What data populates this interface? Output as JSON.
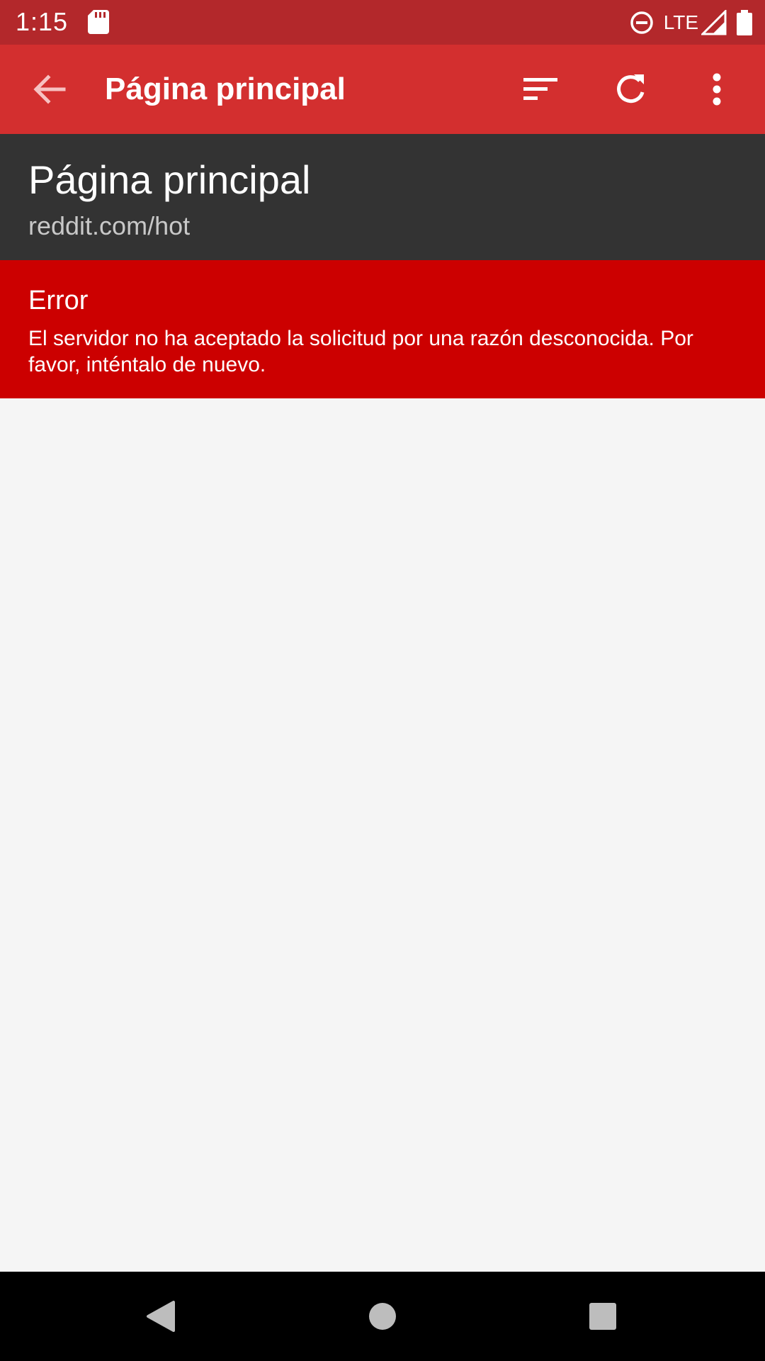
{
  "status_bar": {
    "time": "1:15",
    "network": "LTE",
    "icons": [
      "sd-card-icon",
      "do-not-disturb-icon",
      "signal-icon",
      "battery-icon"
    ]
  },
  "app_bar": {
    "title": "Página principal",
    "background": "#d32f2f",
    "actions": [
      "back-arrow-icon",
      "sort-icon",
      "refresh-icon",
      "more-vert-icon"
    ]
  },
  "subreddit_header": {
    "title": "Página principal",
    "url": "reddit.com/hot",
    "background": "#333333"
  },
  "error": {
    "title": "Error",
    "message": "El servidor no ha aceptado la solicitud por una razón desconocida. Por favor, inténtalo de nuevo.",
    "background": "#cc0000"
  },
  "nav_bar": {
    "buttons": [
      "back-triangle-icon",
      "home-circle-icon",
      "recents-square-icon"
    ]
  }
}
